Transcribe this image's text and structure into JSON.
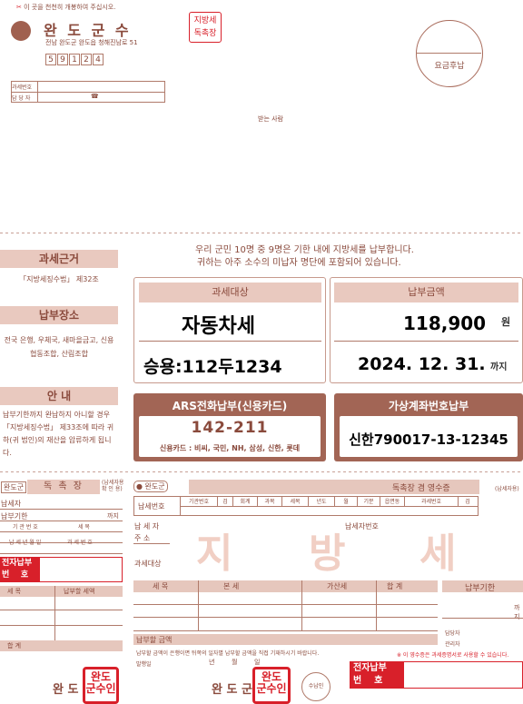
{
  "header": {
    "notice": "이 곳을 천천히 개봉하여 주십시오.",
    "org_name": "완 도 군 수",
    "address": "전남 완도군 완도읍 청해진남로 51",
    "postal_digits": [
      "5",
      "9",
      "1",
      "2",
      "4"
    ],
    "stamp_lines": [
      "지방세",
      "독촉장"
    ],
    "postage_mark": "요금후납",
    "dept_label": "과세번호",
    "manager_label": "담 당 자",
    "phone_icon": "☎",
    "recipient_label": "받는 사람"
  },
  "left_panel": {
    "basis_title": "과세근거",
    "basis_text": "「지방세징수법」 제32조",
    "place_title": "납부장소",
    "place_text": "전국 은행, 우체국, 새마을금고, 신용협동조합, 산림조합",
    "guide_title": "안  내",
    "guide_text": "납부기한까지 완납하지 아니할 경우 「지방세징수법」 제33조에 따라 귀하(귀 법인)의 재산을 압류하게 됩니다."
  },
  "main": {
    "notice_line1": "우리 군민 10명 중 9명은 기한 내에 지방세를 납부합니다.",
    "notice_line2": "귀하는 아주 소수의 미납자 명단에 포함되어 있습니다.",
    "target_header": "과세대상",
    "target_value": "자동차세",
    "target_detail": "승용:112두1234",
    "amount_header": "납부금액",
    "amount_value": "118,900",
    "amount_unit": "원",
    "due_value": "2024. 12. 31.",
    "due_suffix": "까지",
    "ars_title": "ARS전화납부(신용카드)",
    "ars_number": "142-211",
    "ars_cards": "신용카드 : 비씨, 국민, NH, 삼성, 신한, 롯데",
    "virtual_title": "가상계좌번호납부",
    "virtual_value": "신한790017-13-12345"
  },
  "stub_left": {
    "org_tag": "완도군",
    "title": "독 촉 장",
    "small_note": "(납세자용\n확 인 용)",
    "taxpayer": "납세자",
    "due_label": "납부기한",
    "due_suffix": "까지",
    "org_code": "기 관 번 호",
    "item_label": "세    목",
    "year_month": "납 세 년 월 일",
    "tax_no": "과 세 번 호",
    "e_pay": "전자납부\n번    호",
    "item_col": "세    목",
    "amount_col": "납부할 세액",
    "total_label": "합        계",
    "bottom_org": "완 도",
    "seal_text": "완도\n군수인"
  },
  "stub_main": {
    "org_tag": "완도군",
    "title": "독촉장 겸 영수증",
    "taxpayer_copy": "(납세자용)",
    "tax_no_label": "납세번호",
    "columns": [
      "기관번호",
      "검",
      "회계",
      "과목",
      "세목",
      "년도",
      "월",
      "기분",
      "읍면동",
      "과세번호",
      "검"
    ],
    "payer_label": "납 세 자",
    "address_label": "주    소",
    "payer_no_label": "납세자번호",
    "target_label": "과세대상",
    "ghost_text": [
      "지",
      "방",
      "세"
    ],
    "grid_headers": [
      "세    목",
      "본        세",
      "가산세",
      "합    계"
    ],
    "payable_label": "납부할 금액",
    "footer_note": "납부할 금액이 은행이면 뒤쪽의 일자별 납부할 금액을 직접 기재하시기 바랍니다.",
    "receipt_date": "발행일",
    "date_units": [
      "년",
      "월",
      "일"
    ],
    "receipt_note": "※ 이 영수증은 과세증명서로 사용할 수 있습니다.",
    "due_header": "납부기한",
    "due_suffix": "까지",
    "officer1": "담당자",
    "officer2": "관리자",
    "bottom_org": "완 도 군",
    "seal_text": "완도\n군수인",
    "stamp_text": "수납인",
    "e_pay": "전자납부\n번    호"
  },
  "colors": {
    "brand_brown": "#8a4a3c",
    "tan": "#e9c9bf",
    "seal_red": "#d8202a"
  }
}
